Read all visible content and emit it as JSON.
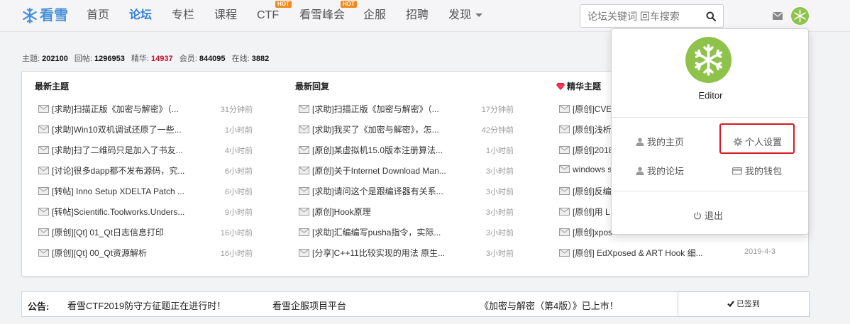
{
  "brand": {
    "name": "看雪"
  },
  "nav": [
    {
      "label": "首页",
      "active": false
    },
    {
      "label": "论坛",
      "active": true
    },
    {
      "label": "专栏",
      "active": false
    },
    {
      "label": "课程",
      "active": false
    },
    {
      "label": "CTF",
      "active": false,
      "badge": "HOT"
    },
    {
      "label": "看雪峰会",
      "active": false,
      "badge": "HOT"
    },
    {
      "label": "企服",
      "active": false
    },
    {
      "label": "招聘",
      "active": false
    },
    {
      "label": "发现",
      "active": false
    }
  ],
  "search": {
    "placeholder": "论坛关键词 回车搜索"
  },
  "stats": {
    "topics_label": "主题:",
    "topics": "202100",
    "replies_label": "回帖:",
    "replies": "1296953",
    "digest_label": "精华:",
    "digest": "14937",
    "members_label": "会员:",
    "members": "844095",
    "online_label": "在线:",
    "online": "3882"
  },
  "columns": {
    "latest_topics": {
      "title": "最新主题",
      "items": [
        {
          "title": "[求助]扫描正版《加密与解密》（...",
          "time": "31分钟前"
        },
        {
          "title": "[求助]Win10双机调试还原了一些...",
          "time": "1小时前"
        },
        {
          "title": "[求助]扫了二维码只是加入了书友...",
          "time": "4小时前"
        },
        {
          "title": "[讨论]很多dapp都不发布源码，究...",
          "time": "6小时前"
        },
        {
          "title": "[转帖] Inno Setup XDELTA Patch ...",
          "time": "6小时前"
        },
        {
          "title": "[转帖]Scientific.Toolworks.Unders...",
          "time": "9小时前"
        },
        {
          "title": "[原创][Qt] 01_Qt日志信息打印",
          "time": "16小时前"
        },
        {
          "title": "[原创][Qt] 00_Qt资源解析",
          "time": "16小时前"
        }
      ]
    },
    "latest_replies": {
      "title": "最新回复",
      "items": [
        {
          "title": "[求助]扫描正版《加密与解密》（...",
          "time": "17分钟前"
        },
        {
          "title": "[求助]我买了《加密与解密》，怎...",
          "time": "42分钟前"
        },
        {
          "title": "[原创]某虚拟机15.0版本注册算法...",
          "time": "1小时前"
        },
        {
          "title": "[原创]关于Internet Download Man...",
          "time": "3小时前"
        },
        {
          "title": "[求助]请问这个是跟编译器有关系...",
          "time": "3小时前"
        },
        {
          "title": "[原创]Hook原理",
          "time": "3小时前"
        },
        {
          "title": "[求助]汇编编写pusha指令，实际...",
          "time": "3小时前"
        },
        {
          "title": "[分享]C++11比较实现的用法 原生...",
          "time": "3小时前"
        }
      ]
    },
    "digest": {
      "title": "精华主题",
      "items": [
        {
          "title": "[原创]CVE"
        },
        {
          "title": "[原创]浅析"
        },
        {
          "title": "[原创]2018"
        },
        {
          "title": "windows s"
        },
        {
          "title": "[原创]反编"
        },
        {
          "title": "[原创]用 L"
        },
        {
          "title": "[原创]xpos"
        },
        {
          "title": "[原创] EdXposed & ART Hook 细...",
          "time": "2019-4-3"
        }
      ]
    }
  },
  "notice": {
    "label": "公告:",
    "links": [
      "看雪CTF2019防守方征题正在进行时！",
      "看雪企服项目平台",
      "《加密与解密（第4版）》已上市！"
    ],
    "checkin": "已签到"
  },
  "user_menu": {
    "username": "Editor",
    "my_home": "我的主页",
    "settings": "个人设置",
    "my_forum": "我的论坛",
    "my_wallet": "我的钱包",
    "logout": "退出"
  },
  "colors": {
    "brand_blue": "#2e7dd7",
    "hot": "#f28b1f",
    "digest_red": "#c0102c",
    "avatar_green": "#8ec24a",
    "highlight": "#d71920"
  }
}
